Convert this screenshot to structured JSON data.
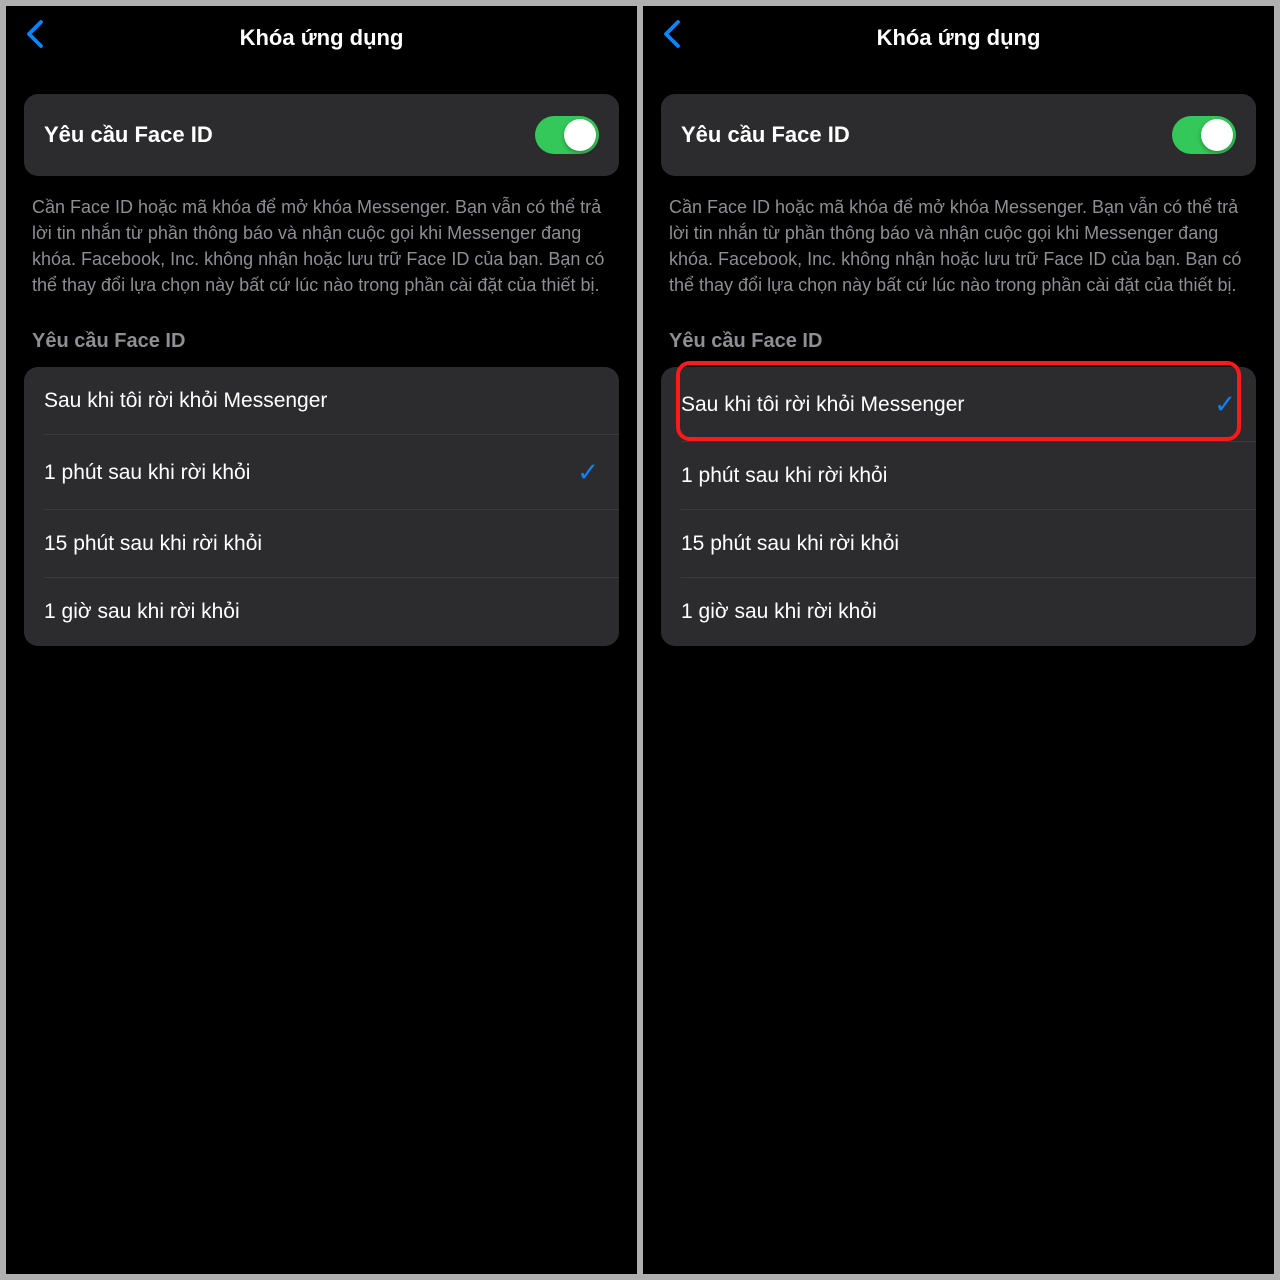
{
  "screens": [
    {
      "title": "Khóa ứng dụng",
      "toggle": {
        "label": "Yêu cầu Face ID",
        "on": true
      },
      "description": "Cần Face ID hoặc mã khóa để mở khóa Messenger. Bạn vẫn có thể trả lời tin nhắn từ phần thông báo và nhận cuộc gọi khi Messenger đang khóa. Facebook, Inc. không nhận hoặc lưu trữ Face ID của bạn. Bạn có thể thay đổi lựa chọn này bất cứ lúc nào trong phần cài đặt của thiết bị.",
      "sectionHeader": "Yêu cầu Face ID",
      "options": [
        {
          "label": "Sau khi tôi rời khỏi Messenger",
          "checked": false
        },
        {
          "label": "1 phút sau khi rời khỏi",
          "checked": true
        },
        {
          "label": "15 phút sau khi rời khỏi",
          "checked": false
        },
        {
          "label": "1 giờ sau khi rời khỏi",
          "checked": false
        }
      ],
      "highlight": null
    },
    {
      "title": "Khóa ứng dụng",
      "toggle": {
        "label": "Yêu cầu Face ID",
        "on": true
      },
      "description": "Cần Face ID hoặc mã khóa để mở khóa Messenger. Bạn vẫn có thể trả lời tin nhắn từ phần thông báo và nhận cuộc gọi khi Messenger đang khóa. Facebook, Inc. không nhận hoặc lưu trữ Face ID của bạn. Bạn có thể thay đổi lựa chọn này bất cứ lúc nào trong phần cài đặt của thiết bị.",
      "sectionHeader": "Yêu cầu Face ID",
      "options": [
        {
          "label": "Sau khi tôi rời khỏi Messenger",
          "checked": true
        },
        {
          "label": "1 phút sau khi rời khỏi",
          "checked": false
        },
        {
          "label": "15 phút sau khi rời khỏi",
          "checked": false
        },
        {
          "label": "1 giờ sau khi rời khỏi",
          "checked": false
        }
      ],
      "highlight": 0
    }
  ],
  "colors": {
    "accent": "#0a84ff",
    "toggleOn": "#34c759",
    "highlight": "#ff1a1a"
  }
}
